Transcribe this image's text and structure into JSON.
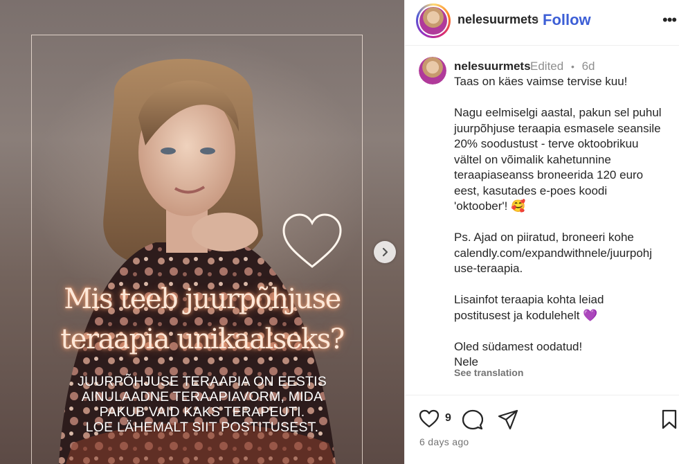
{
  "media": {
    "headline_line1": "Mis teeb juurpõhjuse",
    "headline_line2": "teraapia unikaalseks?",
    "subtext": [
      "JUURPÕHJUSE TERAAPIA ON EESTIS",
      "AINULAADNE TERAAPIAVORM, MIDA",
      "PAKUB VAID KAKS TERAPEUTI.",
      "LOE LÄHEMALT SIIT POSTITUSEST."
    ],
    "next_icon": "chevron-right-icon",
    "heart_icon": "heart-outline-icon"
  },
  "header": {
    "username": "nelesuurmets",
    "separator": "•",
    "follow_label": "Follow",
    "more_label": "•••",
    "follow_color": "#3d5fd6"
  },
  "caption": {
    "username": "nelesuurmets",
    "edited_label": "Edited",
    "separator": "•",
    "age": "6d",
    "lines": [
      "Taas on käes vaimse tervise kuu!",
      "",
      "Nagu eelmiselgi aastal, pakun sel puhul",
      "juurpõhjuse teraapia esmasele seansile",
      "20% soodustust - terve oktoobrikuu",
      "vältel on võimalik kahetunnine",
      "teraapiaseanss broneerida 120 euro",
      "eest, kasutades e-poes koodi",
      "'oktoober'! 🥰",
      "",
      "Ps. Ajad on piiratud, broneeri kohe",
      "calendly.com/expandwithnele/juurpohj",
      "use-teraapia.",
      "",
      "Lisainfot teraapia kohta leiad",
      "postitusest ja kodulehelt 💜",
      "",
      "Oled südamest oodatud!",
      "Nele"
    ],
    "see_translation": "See translation"
  },
  "actions": {
    "like_icon": "heart-icon",
    "like_count": "9",
    "comment_icon": "comment-icon",
    "share_icon": "send-icon",
    "save_icon": "bookmark-icon",
    "time_ago": "6 days ago"
  }
}
